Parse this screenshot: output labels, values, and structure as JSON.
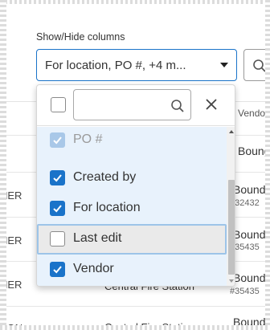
{
  "show_hide": {
    "label": "Show/Hide columns",
    "select_value": "For location, PO #, +4 m..."
  },
  "dropdown": {
    "search_placeholder": "",
    "items": [
      {
        "label": "PO #",
        "checked": true,
        "disabled": true
      },
      {
        "label": "Created by",
        "checked": true,
        "disabled": false
      },
      {
        "label": "For location",
        "checked": true,
        "disabled": false
      },
      {
        "label": "Last edit",
        "checked": false,
        "disabled": false,
        "focused": true
      },
      {
        "label": "Vendor",
        "checked": true,
        "disabled": false
      }
    ]
  },
  "table": {
    "vendor_header": "Vendor",
    "rows": [
      {
        "left": "Boung",
        "left_cut": "",
        "sub": ""
      },
      {
        "left": "Bound",
        "left_cut": "NER",
        "sub": "#32432"
      },
      {
        "left": "Bound",
        "left_cut": "NER",
        "sub": "#35435"
      },
      {
        "left": "Bound",
        "left_cut": "NER",
        "sub": "#35435"
      },
      {
        "left": "Bound",
        "left_cut": "SON",
        "sub": "",
        "mid": "Central Fire Station"
      }
    ],
    "middle_text": "Central Fire Station"
  },
  "colors": {
    "accent": "#1a73c9",
    "list_bg": "#e8f2fc"
  }
}
